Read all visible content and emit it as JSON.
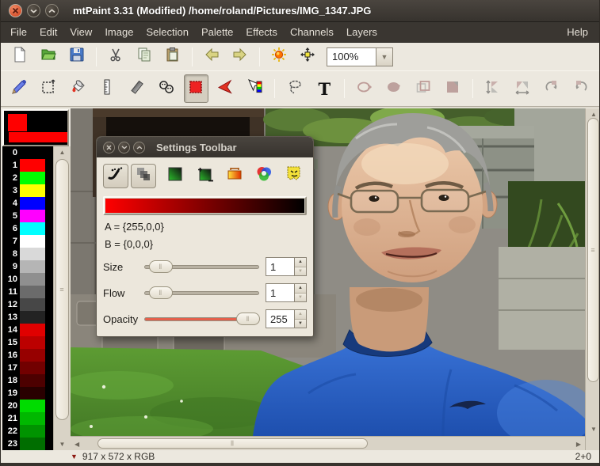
{
  "window": {
    "title": "mtPaint 3.31 (Modified) /home/roland/Pictures/IMG_1347.JPG",
    "controls": [
      "close",
      "minimize",
      "maximize"
    ]
  },
  "menubar": {
    "items": [
      "File",
      "Edit",
      "View",
      "Image",
      "Selection",
      "Palette",
      "Effects",
      "Channels",
      "Layers"
    ],
    "right_item": "Help"
  },
  "main_toolbar": {
    "zoom_value": "100%",
    "icons": [
      "new",
      "open",
      "save",
      "cut",
      "copy",
      "paste",
      "undo",
      "redo",
      "pan-window",
      "view-window",
      "zoom-combo"
    ]
  },
  "tools_toolbar": {
    "icons": [
      "paint",
      "shuffle",
      "flood-fill",
      "straight-line",
      "smudge",
      "clone",
      "make-selection",
      "polygon-selection",
      "place-gradient",
      "lasso",
      "text"
    ],
    "selected_tool": "make-selection",
    "disabled_icons": [
      "ellipse-outline",
      "ellipse-fill",
      "rectangle-outline",
      "rectangle-fill",
      "flip-vertical",
      "flip-horizontal",
      "rotate-clockwise",
      "rotate-anticlockwise"
    ],
    "text_tool_glyph": "T"
  },
  "color_area": {
    "color_a": "#ff0000",
    "color_b": "#000000"
  },
  "palette": {
    "entries": [
      {
        "index": "0",
        "color": "#000000"
      },
      {
        "index": "1",
        "color": "#ff0000"
      },
      {
        "index": "2",
        "color": "#00ff00"
      },
      {
        "index": "3",
        "color": "#ffff00"
      },
      {
        "index": "4",
        "color": "#0000ff"
      },
      {
        "index": "5",
        "color": "#ff00ff"
      },
      {
        "index": "6",
        "color": "#00ffff"
      },
      {
        "index": "7",
        "color": "#ffffff"
      },
      {
        "index": "8",
        "color": "#d9d9d9"
      },
      {
        "index": "9",
        "color": "#b5b5b5"
      },
      {
        "index": "10",
        "color": "#8f8f8f"
      },
      {
        "index": "11",
        "color": "#6b6b6b"
      },
      {
        "index": "12",
        "color": "#474747"
      },
      {
        "index": "13",
        "color": "#232323"
      },
      {
        "index": "14",
        "color": "#e00000"
      },
      {
        "index": "15",
        "color": "#bc0000"
      },
      {
        "index": "16",
        "color": "#970000"
      },
      {
        "index": "17",
        "color": "#720000"
      },
      {
        "index": "18",
        "color": "#4d0000"
      },
      {
        "index": "19",
        "color": "#290000"
      },
      {
        "index": "20",
        "color": "#00dc00"
      },
      {
        "index": "21",
        "color": "#00b800"
      },
      {
        "index": "22",
        "color": "#009300"
      },
      {
        "index": "23",
        "color": "#006e00"
      }
    ]
  },
  "settings_window": {
    "title": "Settings Toolbar",
    "buttons": [
      "continuous-mode",
      "opacity-mode",
      "tint-mode",
      "tint-plus-minus",
      "colorize",
      "rgb-mode",
      "disable-all-masks"
    ],
    "gradient_from": "#ff0000",
    "gradient_to": "#000000",
    "a_label": "A = {255,0,0}",
    "b_label": "B = {0,0,0}",
    "sliders": [
      {
        "label": "Size",
        "value": "1"
      },
      {
        "label": "Flow",
        "value": "1"
      },
      {
        "label": "Opacity",
        "value": "255"
      }
    ]
  },
  "statusbar": {
    "geometry": "917 x 572 x RGB",
    "right_info": "2+0"
  },
  "colors": {
    "titlebar_bg": "#3a3631",
    "close_button": "#d9542f",
    "toolbar_bg": "#ece8df",
    "selection_tool_red": "#ee2222",
    "opacity_track": "#e4604b",
    "shirt_blue": "#2b63c6",
    "grass_green": "#4e8c2d"
  }
}
